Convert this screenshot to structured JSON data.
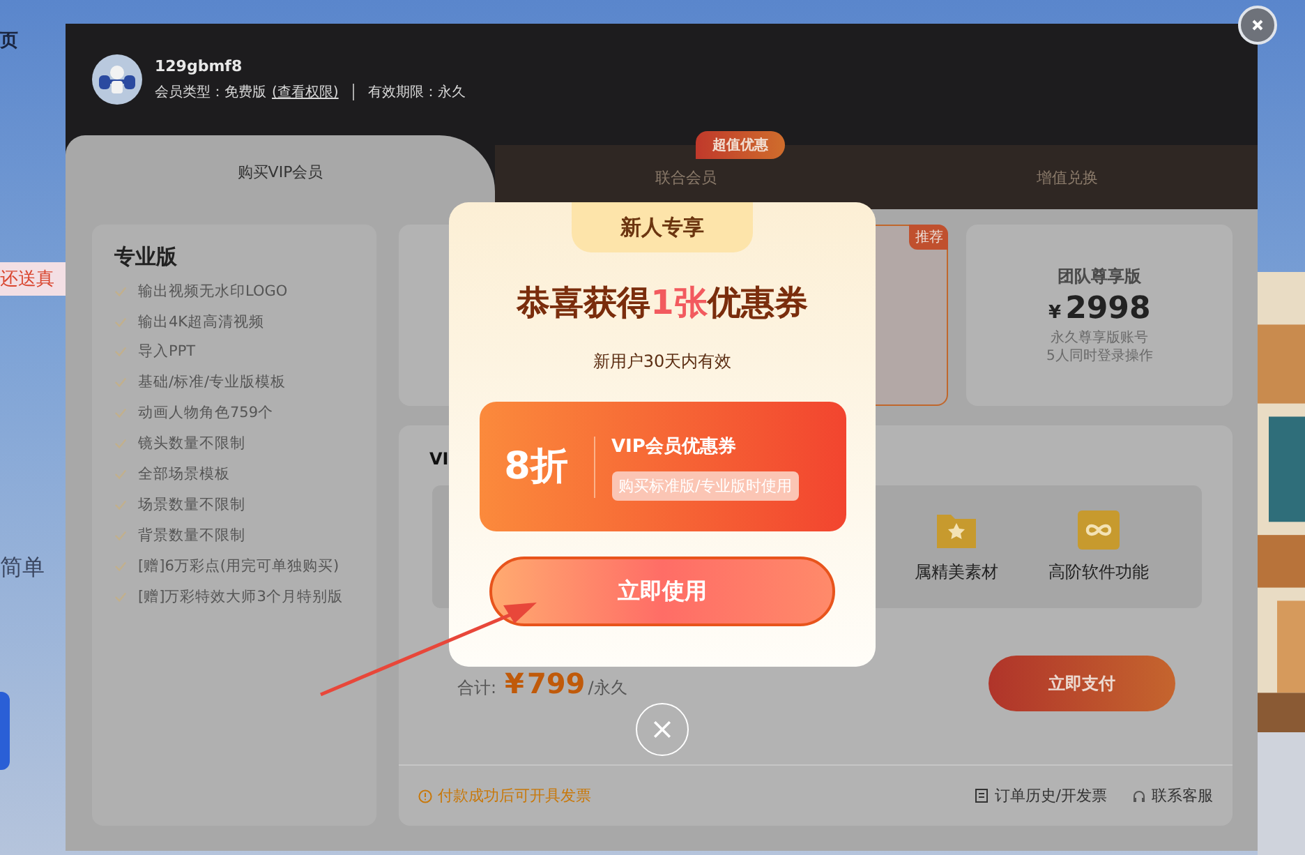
{
  "background_page": {
    "top_text": "页",
    "promo_text": "还送真",
    "sub_text": "简单"
  },
  "dialog": {
    "user": {
      "name": "129gbmf8",
      "member_type": "会员类型：免费版",
      "rights_link": "(查看权限)",
      "validity": "有效期限：永久"
    },
    "tabs": [
      {
        "label": "购买VIP会员",
        "selected": true
      },
      {
        "label": "联合会员",
        "selected": false,
        "badge": "超值优惠"
      },
      {
        "label": "增值兑换",
        "selected": false
      }
    ],
    "edition": {
      "title": "专业版",
      "features": [
        "输出视频无水印LOGO",
        "输出4K超高清视频",
        "导入PPT",
        "基础/标准/专业版模板",
        "动画人物角色759个",
        "镜头数量不限制",
        "全部场景模板",
        "场景数量不限制",
        "背景数量不限制",
        "[赠]6万彩点(用完可单独购买)",
        "[赠]万彩特效大师3个月特别版"
      ]
    },
    "plans": [
      {
        "selected": false
      },
      {
        "selected": true,
        "badge": "推荐"
      },
      {
        "selected": false,
        "name": "团队尊享版",
        "currency": "¥",
        "price": "2998",
        "lines": [
          "永久尊享版账号",
          "5人同时登录操作"
        ]
      }
    ],
    "benefits": {
      "title": "VI",
      "items": [
        "属精美素材",
        "高阶软件功能"
      ]
    },
    "total": {
      "label": "合计:",
      "currency": "¥",
      "amount": "799",
      "unit": "/永久"
    },
    "pay_button": "立即支付",
    "footer": {
      "notice": "付款成功后可开具发票",
      "order_link": "订单历史/开发票",
      "service_link": "联系客服"
    }
  },
  "coupon_popup": {
    "tag": "新人专享",
    "title": "恭喜获得**1张**优惠券",
    "subtitle": "新用户30天内有效",
    "coupon": {
      "discount": "8折",
      "name": "VIP会员优惠券",
      "condition": "购买标准版/专业版时使用"
    },
    "use_button": "立即使用"
  }
}
